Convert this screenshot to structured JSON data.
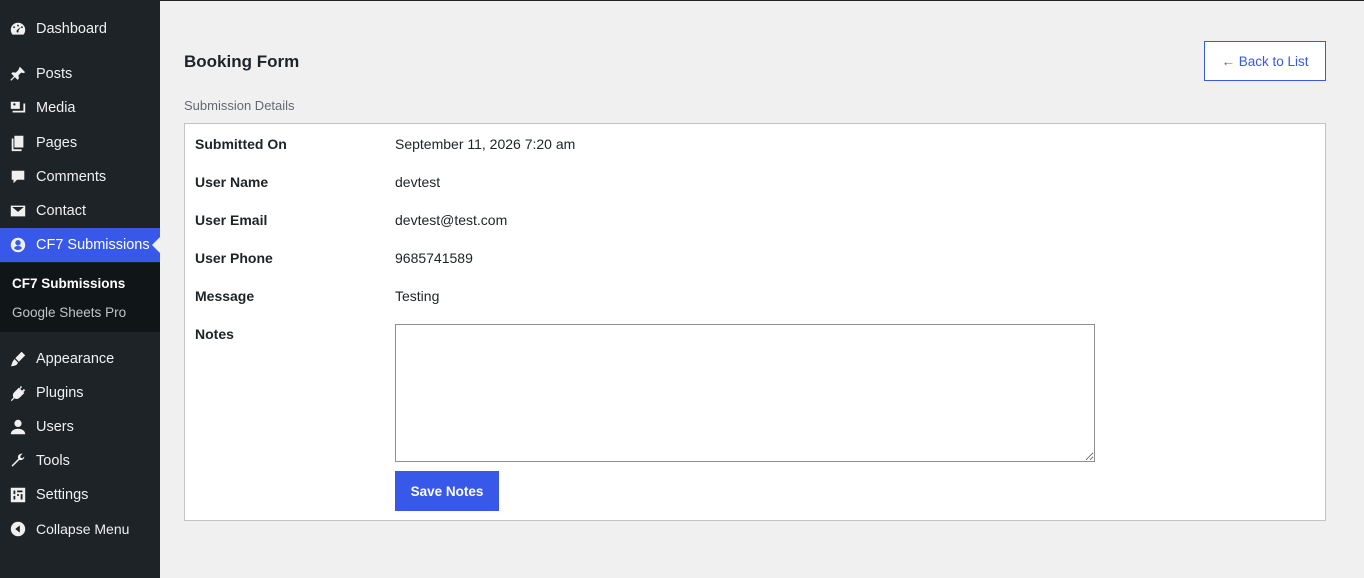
{
  "sidebar": {
    "items": [
      {
        "label": "Dashboard",
        "icon": "dashboard-icon"
      },
      {
        "label": "Posts",
        "icon": "pin-icon"
      },
      {
        "label": "Media",
        "icon": "media-icon"
      },
      {
        "label": "Pages",
        "icon": "pages-icon"
      },
      {
        "label": "Comments",
        "icon": "comment-icon"
      },
      {
        "label": "Contact",
        "icon": "mail-icon"
      },
      {
        "label": "CF7 Submissions",
        "icon": "submissions-icon"
      },
      {
        "label": "Appearance",
        "icon": "brush-icon"
      },
      {
        "label": "Plugins",
        "icon": "plugin-icon"
      },
      {
        "label": "Users",
        "icon": "user-icon"
      },
      {
        "label": "Tools",
        "icon": "wrench-icon"
      },
      {
        "label": "Settings",
        "icon": "settings-icon"
      },
      {
        "label": "Collapse Menu",
        "icon": "collapse-icon"
      }
    ],
    "submenu": [
      {
        "label": "CF7 Submissions"
      },
      {
        "label": "Google Sheets Pro"
      }
    ]
  },
  "main": {
    "title": "Booking Form",
    "back_label": "← Back to List",
    "section_label": "Submission Details",
    "fields": [
      {
        "label": "Submitted On",
        "value": "September 11, 2026 7:20 am"
      },
      {
        "label": "User Name",
        "value": "devtest"
      },
      {
        "label": "User Email",
        "value": "devtest@test.com"
      },
      {
        "label": "User Phone",
        "value": "9685741589"
      },
      {
        "label": "Message",
        "value": "Testing"
      }
    ],
    "notes_label": "Notes",
    "notes_value": "",
    "save_label": "Save Notes"
  },
  "colors": {
    "sidebar_bg": "#1d2327",
    "accent": "#3858e9",
    "page_bg": "#f0f0f1"
  }
}
